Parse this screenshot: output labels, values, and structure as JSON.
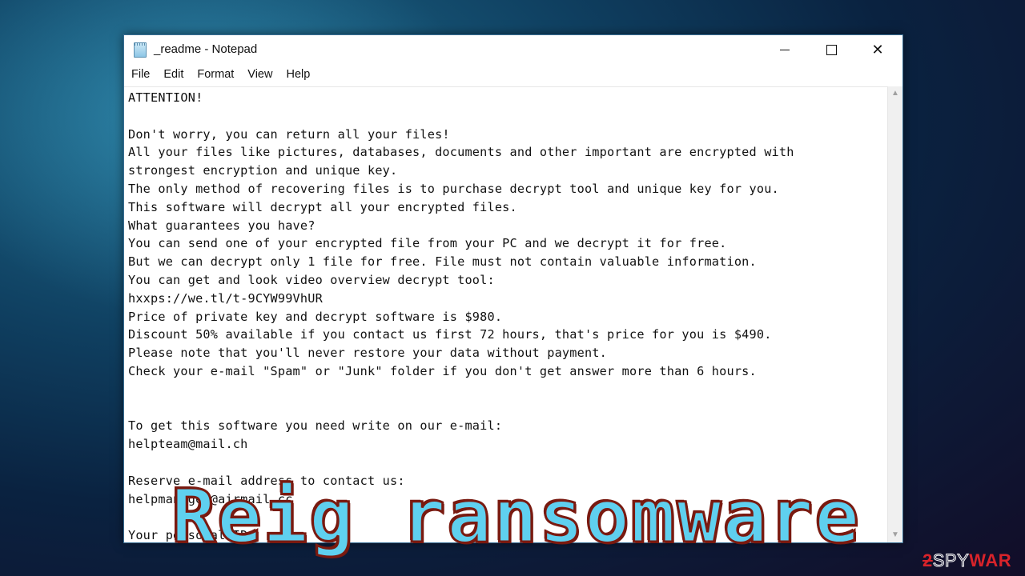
{
  "window": {
    "title": "_readme - Notepad",
    "controls": {
      "minimize": "minimize",
      "maximize": "maximize",
      "close": "close"
    }
  },
  "menu": [
    "File",
    "Edit",
    "Format",
    "View",
    "Help"
  ],
  "document": {
    "lines": [
      "ATTENTION!",
      "",
      "Don't worry, you can return all your files!",
      "All your files like pictures, databases, documents and other important are encrypted with",
      "strongest encryption and unique key.",
      "The only method of recovering files is to purchase decrypt tool and unique key for you.",
      "This software will decrypt all your encrypted files.",
      "What guarantees you have?",
      "You can send one of your encrypted file from your PC and we decrypt it for free.",
      "But we can decrypt only 1 file for free. File must not contain valuable information.",
      "You can get and look video overview decrypt tool:",
      "hxxps://we.tl/t-9CYW99VhUR",
      "Price of private key and decrypt software is $980.",
      "Discount 50% available if you contact us first 72 hours, that's price for you is $490.",
      "Please note that you'll never restore your data without payment.",
      "Check your e-mail \"Spam\" or \"Junk\" folder if you don't get answer more than 6 hours.",
      "",
      "",
      "To get this software you need write on our e-mail:",
      "helpteam@mail.ch",
      "",
      "Reserve e-mail address to contact us:",
      "helpmanager@airmail.cc",
      "",
      "Your personal ID:"
    ]
  },
  "overlay": {
    "title": "Reig ransomware"
  },
  "watermark": {
    "part1": "2",
    "part2": "SPY",
    "part3": "WAR"
  }
}
